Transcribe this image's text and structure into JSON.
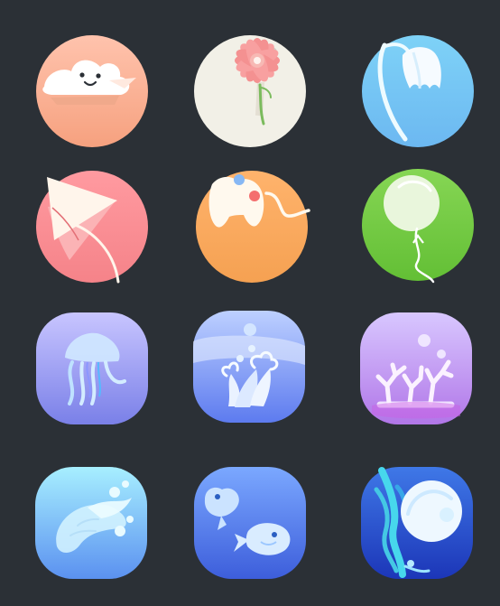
{
  "icon_set": {
    "background_color": "#2b3036",
    "icons": [
      {
        "id": "cloud",
        "shape": "circle",
        "colors": [
          "#ffc3ad",
          "#f6a17f"
        ]
      },
      {
        "id": "flower",
        "shape": "circle",
        "colors": [
          "#f3f1e8",
          "#e4e1d5"
        ]
      },
      {
        "id": "bell-flower",
        "shape": "circle",
        "colors": [
          "#7ed2f7",
          "#6cb8f1"
        ]
      },
      {
        "id": "play-kite",
        "shape": "circle",
        "colors": [
          "#ff9aa0",
          "#f58389"
        ]
      },
      {
        "id": "game-controller",
        "shape": "circle",
        "colors": [
          "#ffb36c",
          "#f5a152"
        ]
      },
      {
        "id": "balloon",
        "shape": "circle",
        "colors": [
          "#86d654",
          "#63bf35"
        ]
      },
      {
        "id": "jellyfish",
        "shape": "squircle",
        "colors": [
          "#c8c5ff",
          "#7a80e8"
        ]
      },
      {
        "id": "seaweed-water",
        "shape": "squircle",
        "colors": [
          "#bdd0ff",
          "#5d7bef"
        ]
      },
      {
        "id": "coral",
        "shape": "squircle",
        "colors": [
          "#d8c7ff",
          "#b176e8"
        ]
      },
      {
        "id": "shell",
        "shape": "squircle",
        "colors": [
          "#a7efff",
          "#5b91f0"
        ]
      },
      {
        "id": "fish",
        "shape": "squircle",
        "colors": [
          "#7ba8ff",
          "#3d5edb"
        ]
      },
      {
        "id": "moon-jelly",
        "shape": "squircle",
        "colors": [
          "#3f78e7",
          "#1c36b8"
        ]
      }
    ]
  }
}
